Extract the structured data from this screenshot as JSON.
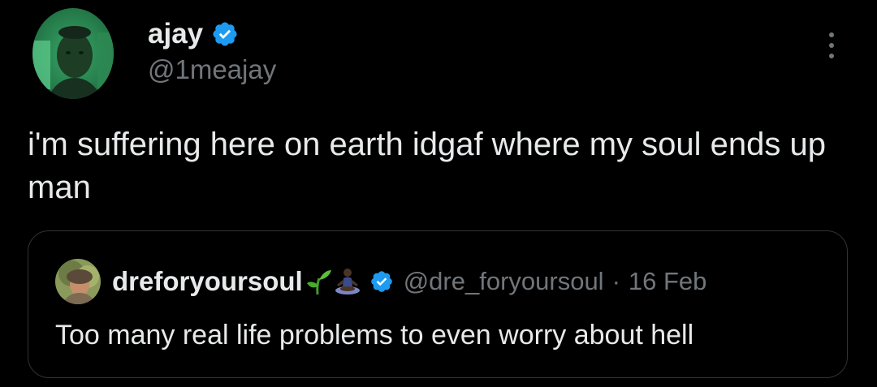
{
  "tweet": {
    "author": {
      "display_name": "ajay",
      "handle": "@1meajay",
      "verified": true,
      "avatar_icon": "profile-photo"
    },
    "text": "i'm suffering here on earth idgaf where my soul ends up man",
    "more_icon": "more-options-icon"
  },
  "quoted_tweet": {
    "author": {
      "display_name": "dreforyoursoul",
      "emoji_icons": [
        "seedling-icon",
        "person-in-lotus-position-icon"
      ],
      "verified": true,
      "handle": "@dre_foryoursoul",
      "avatar_icon": "profile-photo"
    },
    "separator": "·",
    "date": "16 Feb",
    "text": "Too many real life problems to even worry about hell"
  },
  "colors": {
    "background": "#000000",
    "primary_text": "#e7e9ea",
    "secondary_text": "#71767b",
    "verified_blue": "#1d9bf0",
    "border": "#2f3336"
  }
}
